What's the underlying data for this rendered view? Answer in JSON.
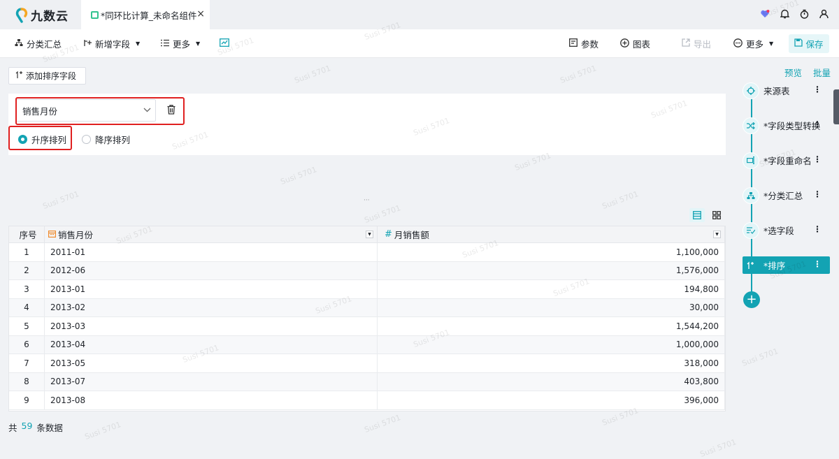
{
  "app": {
    "logo_text": "九数云"
  },
  "tab": {
    "label": "*同环比计算_未命名组件",
    "close": "×"
  },
  "toolbar": {
    "group_summary": "分类汇总",
    "add_field": "新增字段",
    "more_left": "更多",
    "params": "参数",
    "chart": "图表",
    "export": "导出",
    "more_right": "更多",
    "save": "保存"
  },
  "sort_panel": {
    "add_sort_label": "添加排序字段",
    "selected_field": "销售月份",
    "asc_label": "升序排列",
    "desc_label": "降序排列",
    "selected_order": "asc"
  },
  "table": {
    "headers": [
      "序号",
      "销售月份",
      "月销售额"
    ],
    "rows": [
      [
        "1",
        "2011-01",
        "1,100,000"
      ],
      [
        "2",
        "2012-06",
        "1,576,000"
      ],
      [
        "3",
        "2013-01",
        "194,800"
      ],
      [
        "4",
        "2013-02",
        "30,000"
      ],
      [
        "5",
        "2013-03",
        "1,544,200"
      ],
      [
        "6",
        "2013-04",
        "1,000,000"
      ],
      [
        "7",
        "2013-05",
        "318,000"
      ],
      [
        "8",
        "2013-07",
        "403,800"
      ],
      [
        "9",
        "2013-08",
        "396,000"
      ]
    ]
  },
  "footer": {
    "prefix": "共",
    "count": "59",
    "suffix": "条数据"
  },
  "pipeline": {
    "preview": "预览",
    "batch": "批量",
    "steps": [
      {
        "label": "来源表",
        "icon": "crosshair-icon"
      },
      {
        "label": "*字段类型转换",
        "icon": "shuffle-icon"
      },
      {
        "label": "*字段重命名",
        "icon": "rename-icon"
      },
      {
        "label": "*分类汇总",
        "icon": "tree-icon"
      },
      {
        "label": "*选字段",
        "icon": "select-fields-icon"
      },
      {
        "label": "*排序",
        "icon": "sort-icon"
      }
    ],
    "active_step": 5
  },
  "watermark": "Susi 5701",
  "colors": {
    "accent": "#13a3b3",
    "highlight_box": "#e02020"
  }
}
